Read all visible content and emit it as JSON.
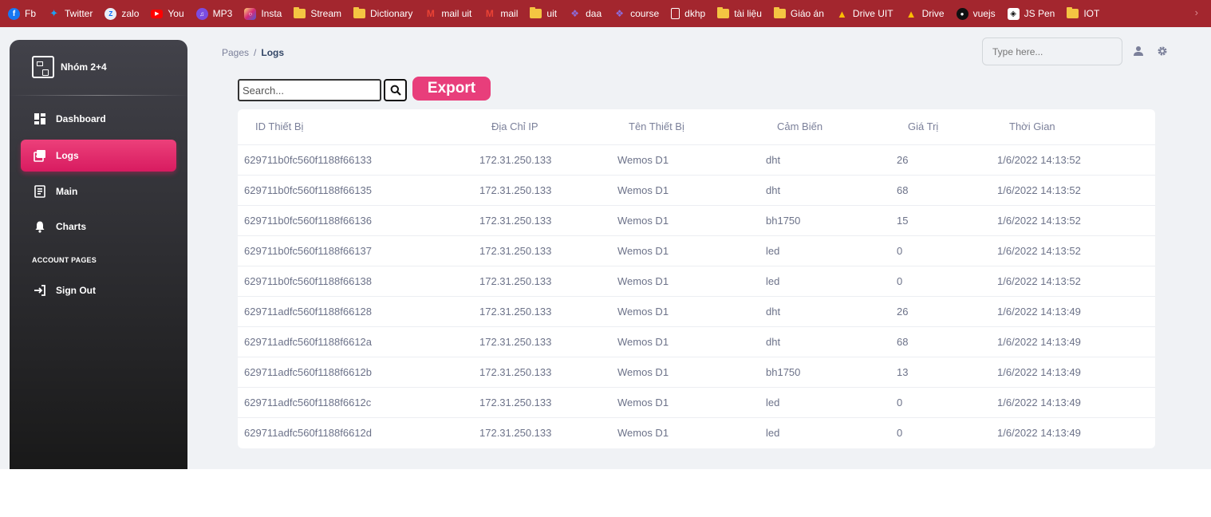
{
  "bookmarks": [
    {
      "label": "Fb",
      "icon": "facebook-icon"
    },
    {
      "label": "Twitter",
      "icon": "twitter-icon"
    },
    {
      "label": "zalo",
      "icon": "zalo-icon"
    },
    {
      "label": "You",
      "icon": "youtube-icon"
    },
    {
      "label": "MP3",
      "icon": "mp3-icon"
    },
    {
      "label": "Insta",
      "icon": "instagram-icon"
    },
    {
      "label": "Stream",
      "icon": "folder-icon"
    },
    {
      "label": "Dictionary",
      "icon": "folder-icon"
    },
    {
      "label": "mail uit",
      "icon": "gmail-icon"
    },
    {
      "label": "mail",
      "icon": "gmail-icon"
    },
    {
      "label": "uit",
      "icon": "folder-icon"
    },
    {
      "label": "daa",
      "icon": "course-icon"
    },
    {
      "label": "course",
      "icon": "course-icon"
    },
    {
      "label": "dkhp",
      "icon": "page-icon"
    },
    {
      "label": "tài liệu",
      "icon": "folder-icon"
    },
    {
      "label": "Giáo án",
      "icon": "folder-icon"
    },
    {
      "label": "Drive UIT",
      "icon": "drive-icon"
    },
    {
      "label": "Drive",
      "icon": "drive-icon"
    },
    {
      "label": "vuejs",
      "icon": "github-icon"
    },
    {
      "label": "JS Pen",
      "icon": "codepen-icon"
    },
    {
      "label": "IOT",
      "icon": "folder-icon"
    }
  ],
  "colors": {
    "bookmark_bar": "#a3262e",
    "accent": "#e91e63",
    "sidebar_top": "#42424a",
    "sidebar_bottom": "#191919"
  },
  "brand": {
    "name": "Nhóm 2+4"
  },
  "sidebar": {
    "items": [
      {
        "label": "Dashboard",
        "icon": "dashboard-icon"
      },
      {
        "label": "Logs",
        "icon": "logs-icon",
        "active": true
      },
      {
        "label": "Main",
        "icon": "receipt-icon"
      },
      {
        "label": "Charts",
        "icon": "bell-icon"
      }
    ],
    "section_label": "ACCOUNT PAGES",
    "account_items": [
      {
        "label": "Sign Out",
        "icon": "sign-in-icon"
      }
    ]
  },
  "breadcrumb": {
    "root": "Pages",
    "separator": "/",
    "current": "Logs"
  },
  "top_search": {
    "placeholder": "Type here..."
  },
  "toolbar": {
    "search_placeholder": "Search...",
    "export_label": "Export"
  },
  "table": {
    "headers": [
      "ID Thiết Bị",
      "Địa Chỉ IP",
      "Tên Thiết Bị",
      "Cảm Biến",
      "Giá Trị",
      "Thời Gian"
    ],
    "rows": [
      [
        "629711b0fc560f1188f66133",
        "172.31.250.133",
        "Wemos D1",
        "dht",
        "26",
        "1/6/2022 14:13:52"
      ],
      [
        "629711b0fc560f1188f66135",
        "172.31.250.133",
        "Wemos D1",
        "dht",
        "68",
        "1/6/2022 14:13:52"
      ],
      [
        "629711b0fc560f1188f66136",
        "172.31.250.133",
        "Wemos D1",
        "bh1750",
        "15",
        "1/6/2022 14:13:52"
      ],
      [
        "629711b0fc560f1188f66137",
        "172.31.250.133",
        "Wemos D1",
        "led",
        "0",
        "1/6/2022 14:13:52"
      ],
      [
        "629711b0fc560f1188f66138",
        "172.31.250.133",
        "Wemos D1",
        "led",
        "0",
        "1/6/2022 14:13:52"
      ],
      [
        "629711adfc560f1188f66128",
        "172.31.250.133",
        "Wemos D1",
        "dht",
        "26",
        "1/6/2022 14:13:49"
      ],
      [
        "629711adfc560f1188f6612a",
        "172.31.250.133",
        "Wemos D1",
        "dht",
        "68",
        "1/6/2022 14:13:49"
      ],
      [
        "629711adfc560f1188f6612b",
        "172.31.250.133",
        "Wemos D1",
        "bh1750",
        "13",
        "1/6/2022 14:13:49"
      ],
      [
        "629711adfc560f1188f6612c",
        "172.31.250.133",
        "Wemos D1",
        "led",
        "0",
        "1/6/2022 14:13:49"
      ],
      [
        "629711adfc560f1188f6612d",
        "172.31.250.133",
        "Wemos D1",
        "led",
        "0",
        "1/6/2022 14:13:49"
      ]
    ]
  }
}
